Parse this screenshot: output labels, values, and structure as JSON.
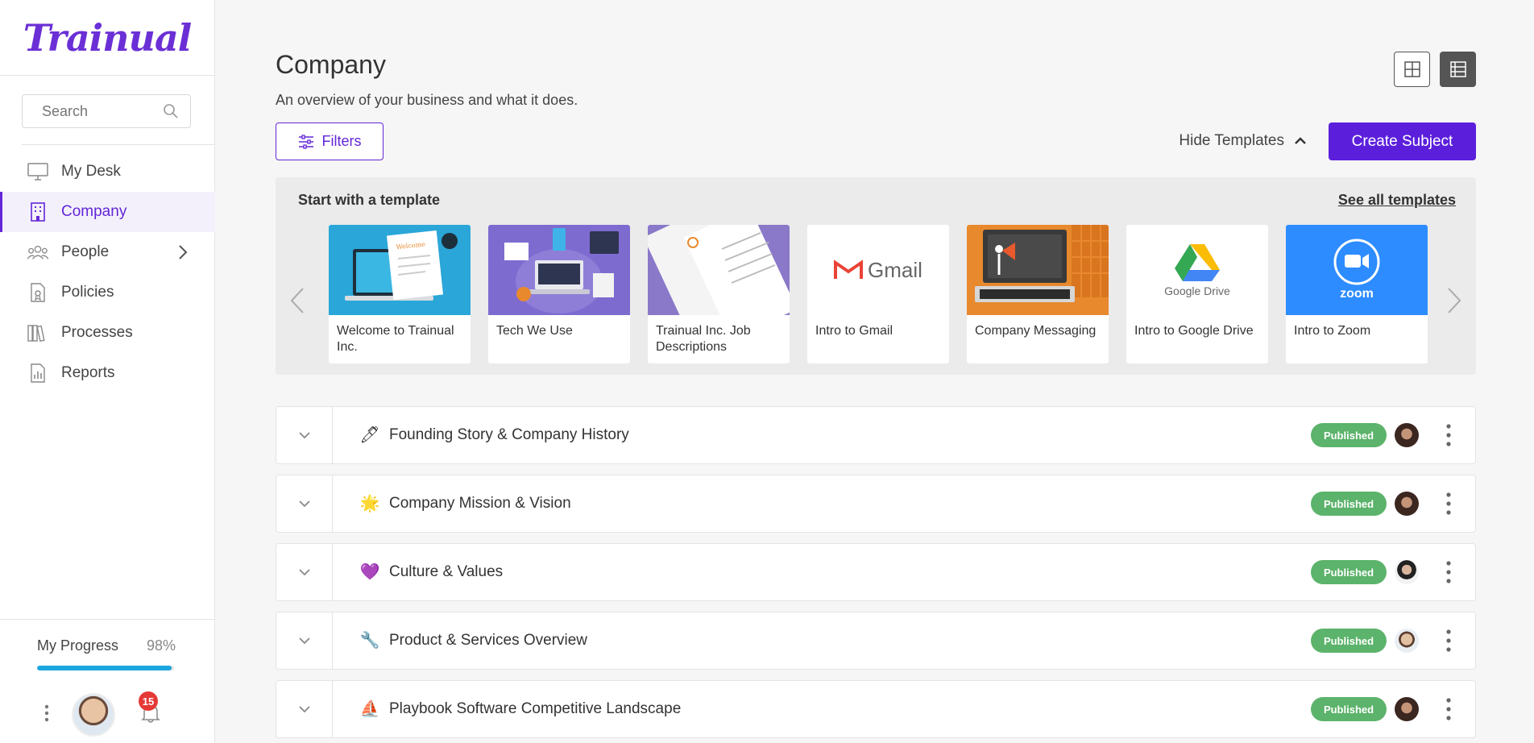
{
  "app": {
    "logo": "Trainual"
  },
  "search": {
    "placeholder": "Search"
  },
  "sidebar": {
    "items": [
      {
        "label": "My Desk",
        "icon": "monitor-icon",
        "active": false
      },
      {
        "label": "Company",
        "icon": "building-icon",
        "active": true
      },
      {
        "label": "People",
        "icon": "people-icon",
        "active": false,
        "has_chevron": true
      },
      {
        "label": "Policies",
        "icon": "policy-doc-icon",
        "active": false
      },
      {
        "label": "Processes",
        "icon": "books-icon",
        "active": false
      },
      {
        "label": "Reports",
        "icon": "report-icon",
        "active": false
      }
    ]
  },
  "progress": {
    "label": "My Progress",
    "value_text": "98%",
    "fraction": 0.98
  },
  "notifications": {
    "count": "15"
  },
  "page": {
    "title": "Company",
    "subtitle": "An overview of your business and what it does."
  },
  "toolbar": {
    "filters_label": "Filters",
    "hide_templates_label": "Hide Templates",
    "create_label": "Create Subject"
  },
  "templates": {
    "heading": "Start with a template",
    "see_all": "See all templates",
    "cards": [
      {
        "label": "Welcome to Trainual Inc.",
        "image": "welcome-laptop",
        "bg": "#2aa6d8"
      },
      {
        "label": "Tech We Use",
        "image": "tech-desk",
        "bg": "#7e6bd0"
      },
      {
        "label": "Trainual Inc. Job Descriptions",
        "image": "job-docs",
        "bg": "#8a78c9"
      },
      {
        "label": "Intro to Gmail",
        "image": "gmail-logo",
        "logo_text": "Gmail",
        "bg": "#ffffff"
      },
      {
        "label": "Company Messaging",
        "image": "messaging-laptop",
        "bg": "#e8892e"
      },
      {
        "label": "Intro to Google Drive",
        "image": "drive-logo",
        "logo_text": "Google Drive",
        "bg": "#ffffff"
      },
      {
        "label": "Intro to Zoom",
        "image": "zoom-logo",
        "logo_text": "zoom",
        "bg": "#2d8cff"
      }
    ]
  },
  "subjects": [
    {
      "name": "Founding Story & Company History",
      "emoji": "🖊",
      "status": "Published"
    },
    {
      "name": "Company Mission & Vision",
      "emoji": "🌟",
      "status": "Published"
    },
    {
      "name": "Culture & Values",
      "emoji": "💜",
      "status": "Published"
    },
    {
      "name": "Product & Services Overview",
      "emoji": "🔧",
      "status": "Published"
    },
    {
      "name": "Playbook Software Competitive Landscape",
      "emoji": "⛵",
      "status": "Published"
    }
  ],
  "colors": {
    "accent": "#5b1fdc",
    "published": "#5cb36b",
    "progress": "#1ca6e0"
  }
}
